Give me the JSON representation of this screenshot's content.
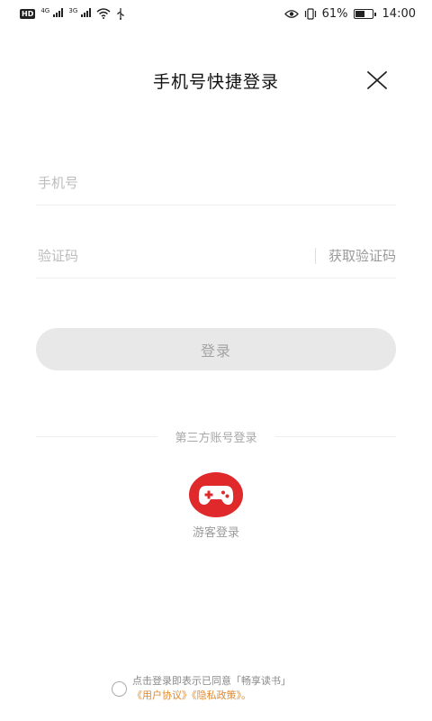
{
  "status_bar": {
    "hd": "HD",
    "net1": "4G",
    "net2": "3G",
    "battery_percent": "61%",
    "battery_level": 0.61,
    "time": "14:00"
  },
  "header": {
    "title": "手机号快捷登录",
    "close_icon": "close-icon"
  },
  "form": {
    "phone_placeholder": "手机号",
    "code_placeholder": "验证码",
    "get_code_label": "获取验证码",
    "login_label": "登录"
  },
  "third_party": {
    "label": "第三方账号登录",
    "guest_label": "游客登录",
    "guest_icon": "gamepad-icon",
    "guest_color": "#e0292a"
  },
  "agreement": {
    "text": "点击登录即表示已同意「畅享读书」",
    "user_agreement": "《用户协议》",
    "privacy_policy": "《隐私政策》",
    "suffix": "。",
    "link_color": "#e08a2f"
  }
}
